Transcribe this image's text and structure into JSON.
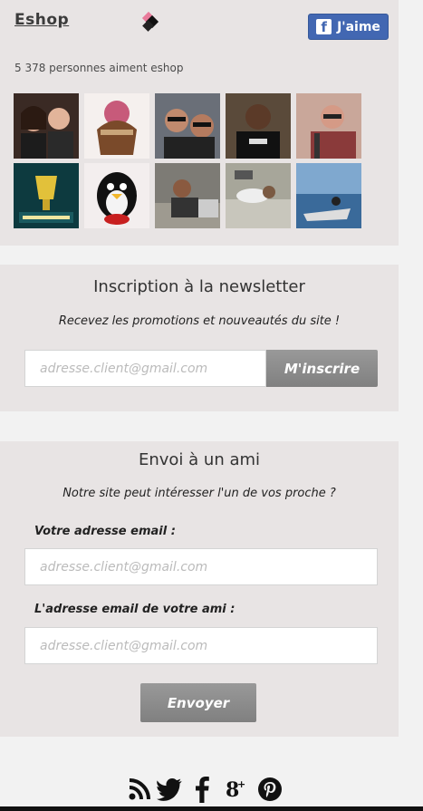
{
  "facebook": {
    "page_name": "Eshop",
    "like_label": "J'aime",
    "likes_text": "5 378 personnes aiment eshop"
  },
  "newsletter": {
    "title": "Inscription à la newsletter",
    "subtitle": "Recevez les promotions et nouveautés du site !",
    "email_placeholder": "adresse.client@gmail.com",
    "submit_label": "M'inscrire"
  },
  "send_to_friend": {
    "title": "Envoi à un ami",
    "subtitle": "Notre site peut intéresser l'un de vos proche ?",
    "your_email_label": "Votre adresse email :",
    "your_email_placeholder": "adresse.client@gmail.com",
    "friend_email_label": "L'adresse email de votre ami :",
    "friend_email_placeholder": "adresse.client@gmail.com",
    "submit_label": "Envoyer"
  },
  "social_icons": [
    "rss-icon",
    "twitter-icon",
    "facebook-icon",
    "google-plus-icon",
    "pinterest-icon"
  ],
  "colors": {
    "facebook_blue": "#4267b2",
    "panel_bg": "#e8e4e4",
    "button_grey": "#8c8c8c"
  }
}
